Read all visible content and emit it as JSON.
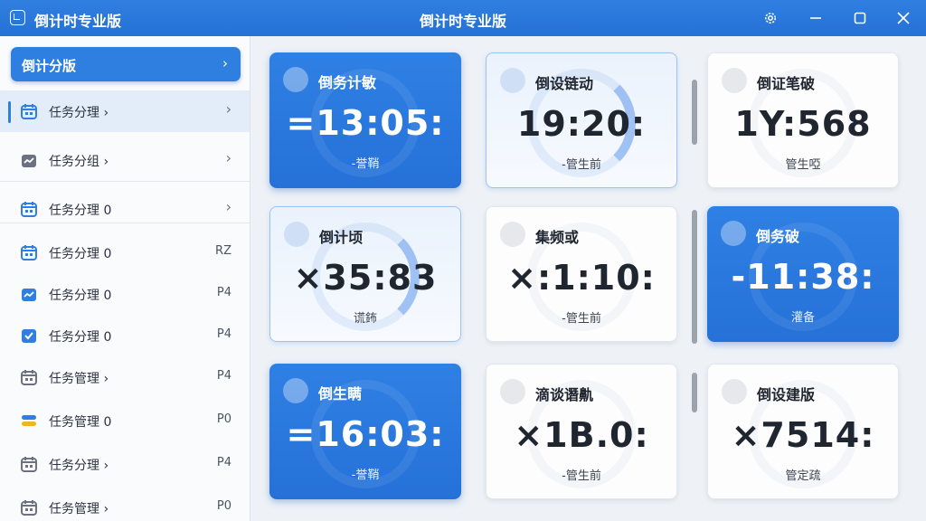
{
  "titlebar": {
    "app_name": "倒计时专业版",
    "title": "倒计时专业版"
  },
  "sidebar": {
    "header": {
      "label": "倒计分版",
      "chevron": "›"
    },
    "items": [
      {
        "label": "任务分理 ›",
        "tail": "›",
        "icon": "calendar-icon",
        "color": "#2f7fe0",
        "active": true
      },
      {
        "label": "任务分组 ›",
        "tail": "›",
        "icon": "chart-icon",
        "color": "#6b7280"
      },
      {
        "label": "任务分理 0",
        "tail": "›",
        "icon": "calendar-icon",
        "color": "#2f7fe0"
      },
      {
        "label": "任务分理 0",
        "tail": "RZ",
        "icon": "calendar-icon",
        "color": "#2f7fe0"
      },
      {
        "label": "任务分理 0",
        "tail": "P4",
        "icon": "chart-icon",
        "color": "#2f7fe0"
      },
      {
        "label": "任务分理 0",
        "tail": "P4",
        "icon": "check-icon",
        "color": "#2f7fe0"
      },
      {
        "label": "任务管理 ›",
        "tail": "P4",
        "icon": "calendar-icon",
        "color": "#6b7280"
      },
      {
        "label": "任务管理 0",
        "tail": "P0",
        "icon": "layers-icon",
        "color": "#f0b429"
      },
      {
        "label": "任务分理 ›",
        "tail": "P4",
        "icon": "calendar-icon",
        "color": "#6b7280"
      },
      {
        "label": "任务管理 ›",
        "tail": "P0",
        "icon": "calendar-icon",
        "color": "#6b7280"
      }
    ]
  },
  "cards": [
    {
      "title": "倒务计敏",
      "time": "=13:05:",
      "sub": "-誉鞘",
      "style": "blue"
    },
    {
      "title": "倒设链动",
      "time": "19:20:",
      "sub": "-管生前",
      "style": "glass"
    },
    {
      "title": "倒证笔破",
      "time": "1Y:568",
      "sub": "管生啞",
      "style": "white"
    },
    {
      "title": "倒计顷",
      "time": "×35:83",
      "sub": "谎鈽",
      "style": "glass"
    },
    {
      "title": "集频或",
      "time": "×:1:10:",
      "sub": "-管生前",
      "style": "white"
    },
    {
      "title": "倒务破",
      "time": "-11:38:",
      "sub": "灌备",
      "style": "blue"
    },
    {
      "title": "倒生瞒",
      "time": "=16:03:",
      "sub": "-誉鞘",
      "style": "blue"
    },
    {
      "title": "滴谈谮鼽",
      "time": "×1B.0:",
      "sub": "-管生前",
      "style": "white"
    },
    {
      "title": "倒设建版",
      "time": "×7514:",
      "sub": "管定疏",
      "style": "white"
    }
  ],
  "colors": {
    "accent": "#2f7fe0",
    "titlebar": "#2571d6",
    "background": "#eef2f7"
  }
}
